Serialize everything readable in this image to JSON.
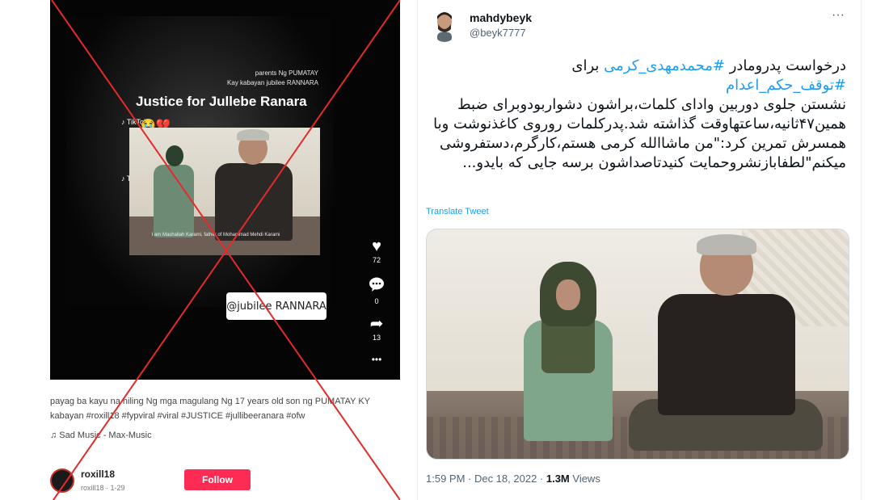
{
  "tiktok": {
    "overlay_line1": "parents Ng PUMATAY",
    "overlay_line2": "Kay kabayan jubilee RANNARA",
    "headline": "Justice for Jullebe Ranara",
    "emoji": "😭💔",
    "watermark": "TikTok",
    "subtitle": "I am Mashallah Karami, father of Mohammad Mehdi Karami",
    "tag": "@jubilee RANNARA",
    "likes": "72",
    "comments": "0",
    "shares": "13",
    "more": "•••",
    "description": "payag ba kayu na hiling Ng mga magulang Ng 17 years old son ng PUMATAY KY kabayan #roxill18 #fypviral #viral #JUSTICE #jullibeeranara #ofw",
    "music": "♫ Sad Music - Max-Music",
    "username": "roxill18",
    "user_sub": "roxill18 · 1-29",
    "follow_label": "Follow",
    "cross_color": "#e32b2b"
  },
  "tweet": {
    "name": "mahdybeyk",
    "handle": "@beyk7777",
    "more": "···",
    "text_a": "درخواست پدرومادر ",
    "tag_a": "#محمدمهدی_کرمی",
    "text_b": " برای",
    "tag_b": "#توقف_حکم_اعدام",
    "text_c": "نشستن جلوی دوربین وادای کلمات،براشون دشواربودوبرای ضبط همین۴۷ثانیه،ساعتهاوقت گذاشته شد.پدرکلمات روروی کاغذنوشت وبا همسرش تمرین کرد:\"من ماشاالله کرمی هستم،کارگرم،دستفروشی میکنم\"لطفابازنشروحمایت کنیدتاصداشون برسه جایی که بایدو...",
    "translate": "Translate Tweet",
    "time": "1:59 PM · Dec 18, 2022 · ",
    "views_count": "1.3M",
    "views_label": " Views",
    "link_color": "#1d9bf0"
  }
}
